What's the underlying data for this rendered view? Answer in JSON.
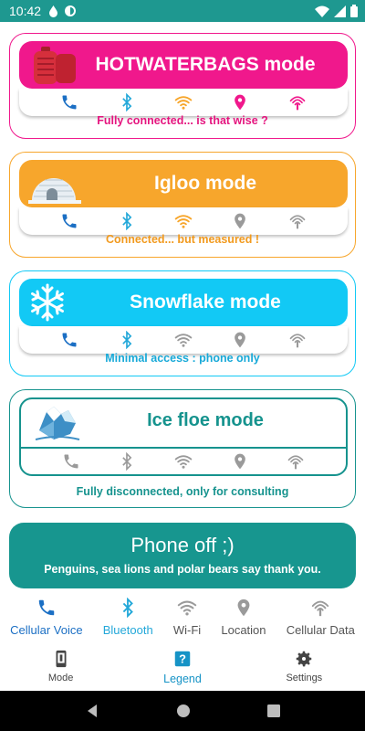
{
  "status_bar": {
    "time": "10:42"
  },
  "colors": {
    "status_bar": "#1e9890",
    "hotwaterbags": "#f0188c",
    "igloo": "#f7a62c",
    "snowflake": "#12c9f5",
    "icefloe": "#16938e",
    "phone_off": "#17968f",
    "legend_active": "#1693c6",
    "inactive_gray": "#9a9a9a"
  },
  "modes": [
    {
      "title": "HOTWATERBAGS mode",
      "caption": "Fully connected... is that wise ?",
      "icon": "hot-water-bag-icon",
      "states": [
        "active",
        "active",
        "active",
        "active",
        "active"
      ]
    },
    {
      "title": "Igloo mode",
      "caption": "Connected... but measured !",
      "icon": "igloo-icon",
      "states": [
        "active",
        "active",
        "active",
        "inactive",
        "inactive"
      ]
    },
    {
      "title": "Snowflake mode",
      "caption": "Minimal access : phone only",
      "icon": "snowflake-icon",
      "states": [
        "active",
        "active",
        "inactive",
        "inactive",
        "inactive"
      ]
    },
    {
      "title": "Ice floe mode",
      "caption": "Fully disconnected, only for consulting",
      "icon": "ice-floe-icon",
      "states": [
        "inactive",
        "inactive",
        "inactive",
        "inactive",
        "inactive"
      ]
    }
  ],
  "phone_off": {
    "title": "Phone off ;)",
    "subtitle": "Penguins, sea lions and polar bears say thank you."
  },
  "legend": [
    {
      "label": "Cellular Voice",
      "icon": "phone-icon"
    },
    {
      "label": "Bluetooth",
      "icon": "bluetooth-icon"
    },
    {
      "label": "Wi-Fi",
      "icon": "wifi-icon"
    },
    {
      "label": "Location",
      "icon": "location-icon"
    },
    {
      "label": "Cellular Data",
      "icon": "cellular-data-icon"
    }
  ],
  "nav": [
    {
      "label": "Mode",
      "icon": "phone-device-icon"
    },
    {
      "label": "Legend",
      "icon": "help-icon",
      "active": true
    },
    {
      "label": "Settings",
      "icon": "gear-icon"
    }
  ]
}
